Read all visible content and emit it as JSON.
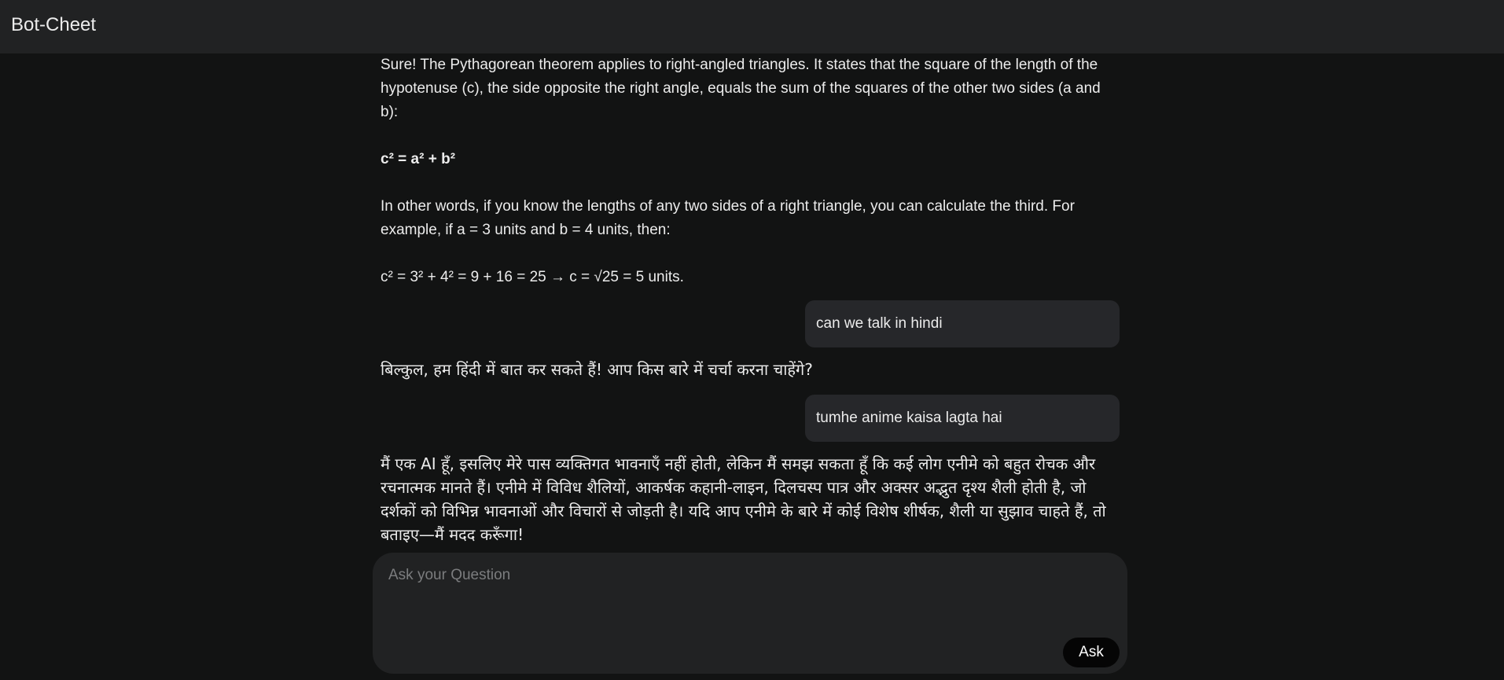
{
  "app": {
    "title": "Bot-Cheet"
  },
  "messages": [
    {
      "role": "bot",
      "paragraphs": [
        "Sure! The Pythagorean theorem applies to right-angled triangles. It states that the square of the length of the hypotenuse (c), the side opposite the right angle, equals the sum of the squares of the other two sides (a and b):",
        "c² = a² + b²",
        "In other words, if you know the lengths of any two sides of a right triangle, you can calculate the third. For example, if a = 3 units and b = 4 units, then:",
        "c² = 3² + 4² = 9 + 16 = 25 → c = √25 = 5 units."
      ]
    },
    {
      "role": "user",
      "text": "can we talk in hindi"
    },
    {
      "role": "bot",
      "text": "बिल्कुल, हम हिंदी में बात कर सकते हैं! आप किस बारे में चर्चा करना चाहेंगे?"
    },
    {
      "role": "user",
      "text": "tumhe anime kaisa lagta hai"
    },
    {
      "role": "bot",
      "text": "मैं एक AI हूँ, इसलिए मेरे पास व्यक्तिगत भावनाएँ नहीं होती, लेकिन मैं समझ सकता हूँ कि कई लोग एनीमे को बहुत रोचक और रचनात्मक मानते हैं। एनीमे में विविध शैलियों, आकर्षक कहानी-लाइन, दिलचस्प पात्र और अक्सर अद्भुत दृश्य शैली होती है, जो दर्शकों को विभिन्न भावनाओं और विचारों से जोड़ती है। यदि आप एनीमे के बारे में कोई विशेष शीर्षक, शैली या सुझाव चाहते हैं, तो बताइए—मैं मदद करूँगा!"
    }
  ],
  "composer": {
    "placeholder": "Ask your Question",
    "value": "",
    "ask_label": "Ask"
  },
  "colors": {
    "background": "#121313",
    "topbar": "#212223",
    "bubble": "#26272a",
    "text": "#ececec",
    "ask_button": "#050505"
  }
}
